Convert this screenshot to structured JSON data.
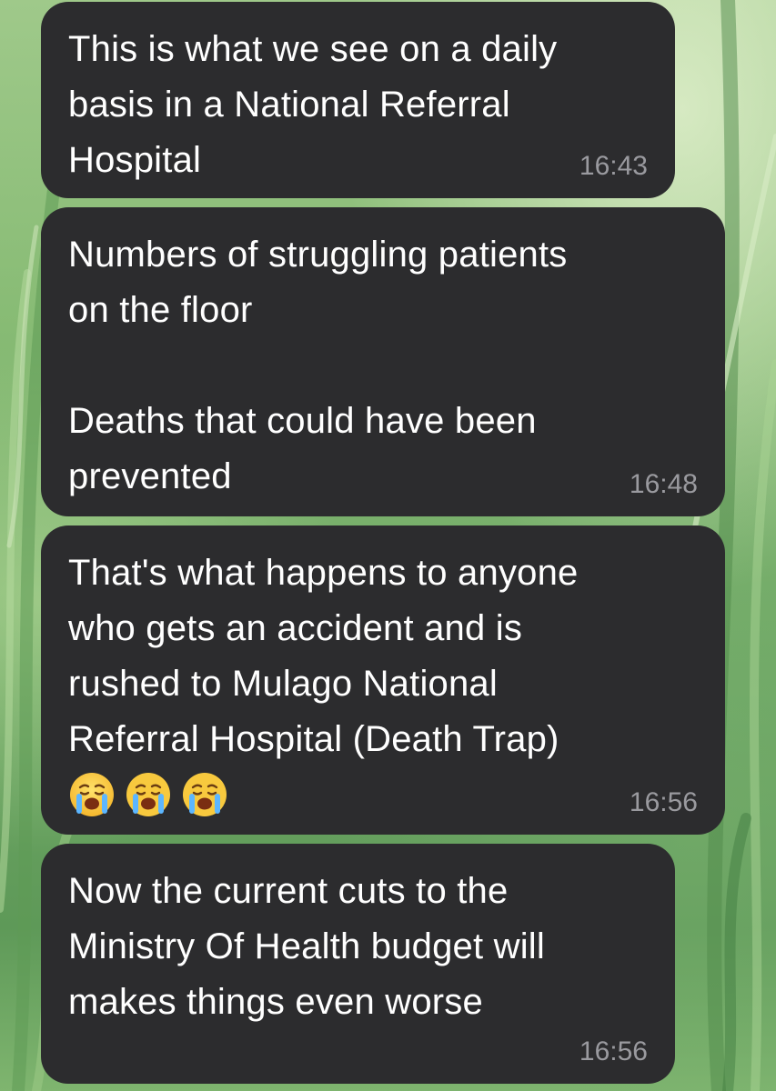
{
  "colors": {
    "bubble_bg": "#2c2c2e",
    "text": "#ffffff",
    "timestamp": "#9a9a9f",
    "wallpaper_green": "#7fb56f"
  },
  "messages": [
    {
      "text": "This is what we see on a daily\nbasis in a National Referral\nHospital",
      "time": "16:43"
    },
    {
      "text": "Numbers of struggling patients\non the floor\n\nDeaths that could have been\nprevented",
      "time": "16:48"
    },
    {
      "text": "That's what happens to anyone\nwho gets an accident and is\nrushed to Mulago National\nReferral Hospital (Death Trap)",
      "emojis": [
        "loudly-crying-face-icon",
        "loudly-crying-face-icon",
        "loudly-crying-face-icon"
      ],
      "time": "16:56"
    },
    {
      "text": "Now the current cuts to the\nMinistry Of Health budget will\nmakes things even worse",
      "time": "16:56"
    }
  ]
}
